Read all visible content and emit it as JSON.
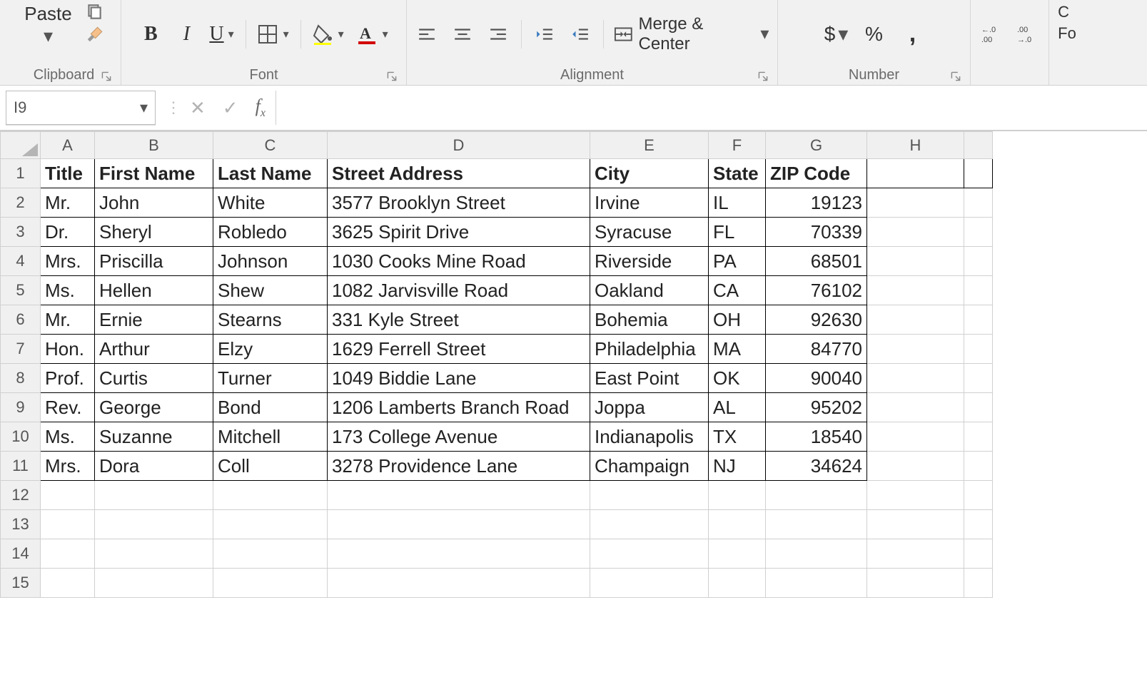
{
  "ribbon": {
    "clipboard": {
      "label": "Clipboard",
      "paste": "Paste"
    },
    "font": {
      "label": "Font",
      "bold": "B",
      "italic": "I",
      "underline": "U"
    },
    "alignment": {
      "label": "Alignment",
      "merge_center": "Merge & Center"
    },
    "number": {
      "label": "Number",
      "currency": "$",
      "percent": "%",
      "comma": ","
    },
    "extra": {
      "fo": "Fo",
      "c": "C"
    }
  },
  "name_box": "I9",
  "formula": "",
  "columns": [
    "A",
    "B",
    "C",
    "D",
    "E",
    "F",
    "G",
    "H",
    ""
  ],
  "row_headers": [
    "1",
    "2",
    "3",
    "4",
    "5",
    "6",
    "7",
    "8",
    "9",
    "10",
    "11",
    "12",
    "13",
    "14",
    "15"
  ],
  "table": {
    "headers": [
      "Title",
      "First Name",
      "Last Name",
      "Street Address",
      "City",
      "State",
      "ZIP Code"
    ],
    "rows": [
      [
        "Mr.",
        "John",
        "White",
        "3577 Brooklyn Street",
        "Irvine",
        "IL",
        "19123"
      ],
      [
        "Dr.",
        "Sheryl",
        "Robledo",
        "3625 Spirit Drive",
        "Syracuse",
        "FL",
        "70339"
      ],
      [
        "Mrs.",
        "Priscilla",
        "Johnson",
        "1030 Cooks Mine Road",
        "Riverside",
        "PA",
        "68501"
      ],
      [
        "Ms.",
        "Hellen",
        "Shew",
        "1082 Jarvisville Road",
        "Oakland",
        "CA",
        "76102"
      ],
      [
        "Mr.",
        "Ernie",
        "Stearns",
        "331 Kyle Street",
        "Bohemia",
        "OH",
        "92630"
      ],
      [
        "Hon.",
        "Arthur",
        "Elzy",
        "1629 Ferrell Street",
        "Philadelphia",
        "MA",
        "84770"
      ],
      [
        "Prof.",
        "Curtis",
        "Turner",
        "1049 Biddie Lane",
        "East Point",
        "OK",
        "90040"
      ],
      [
        "Rev.",
        "George",
        "Bond",
        "1206 Lamberts Branch Road",
        "Joppa",
        "AL",
        "95202"
      ],
      [
        "Ms.",
        "Suzanne",
        "Mitchell",
        "173 College Avenue",
        "Indianapolis",
        "TX",
        "18540"
      ],
      [
        "Mrs.",
        "Dora",
        "Coll",
        "3278 Providence Lane",
        "Champaign",
        "NJ",
        "34624"
      ]
    ]
  }
}
